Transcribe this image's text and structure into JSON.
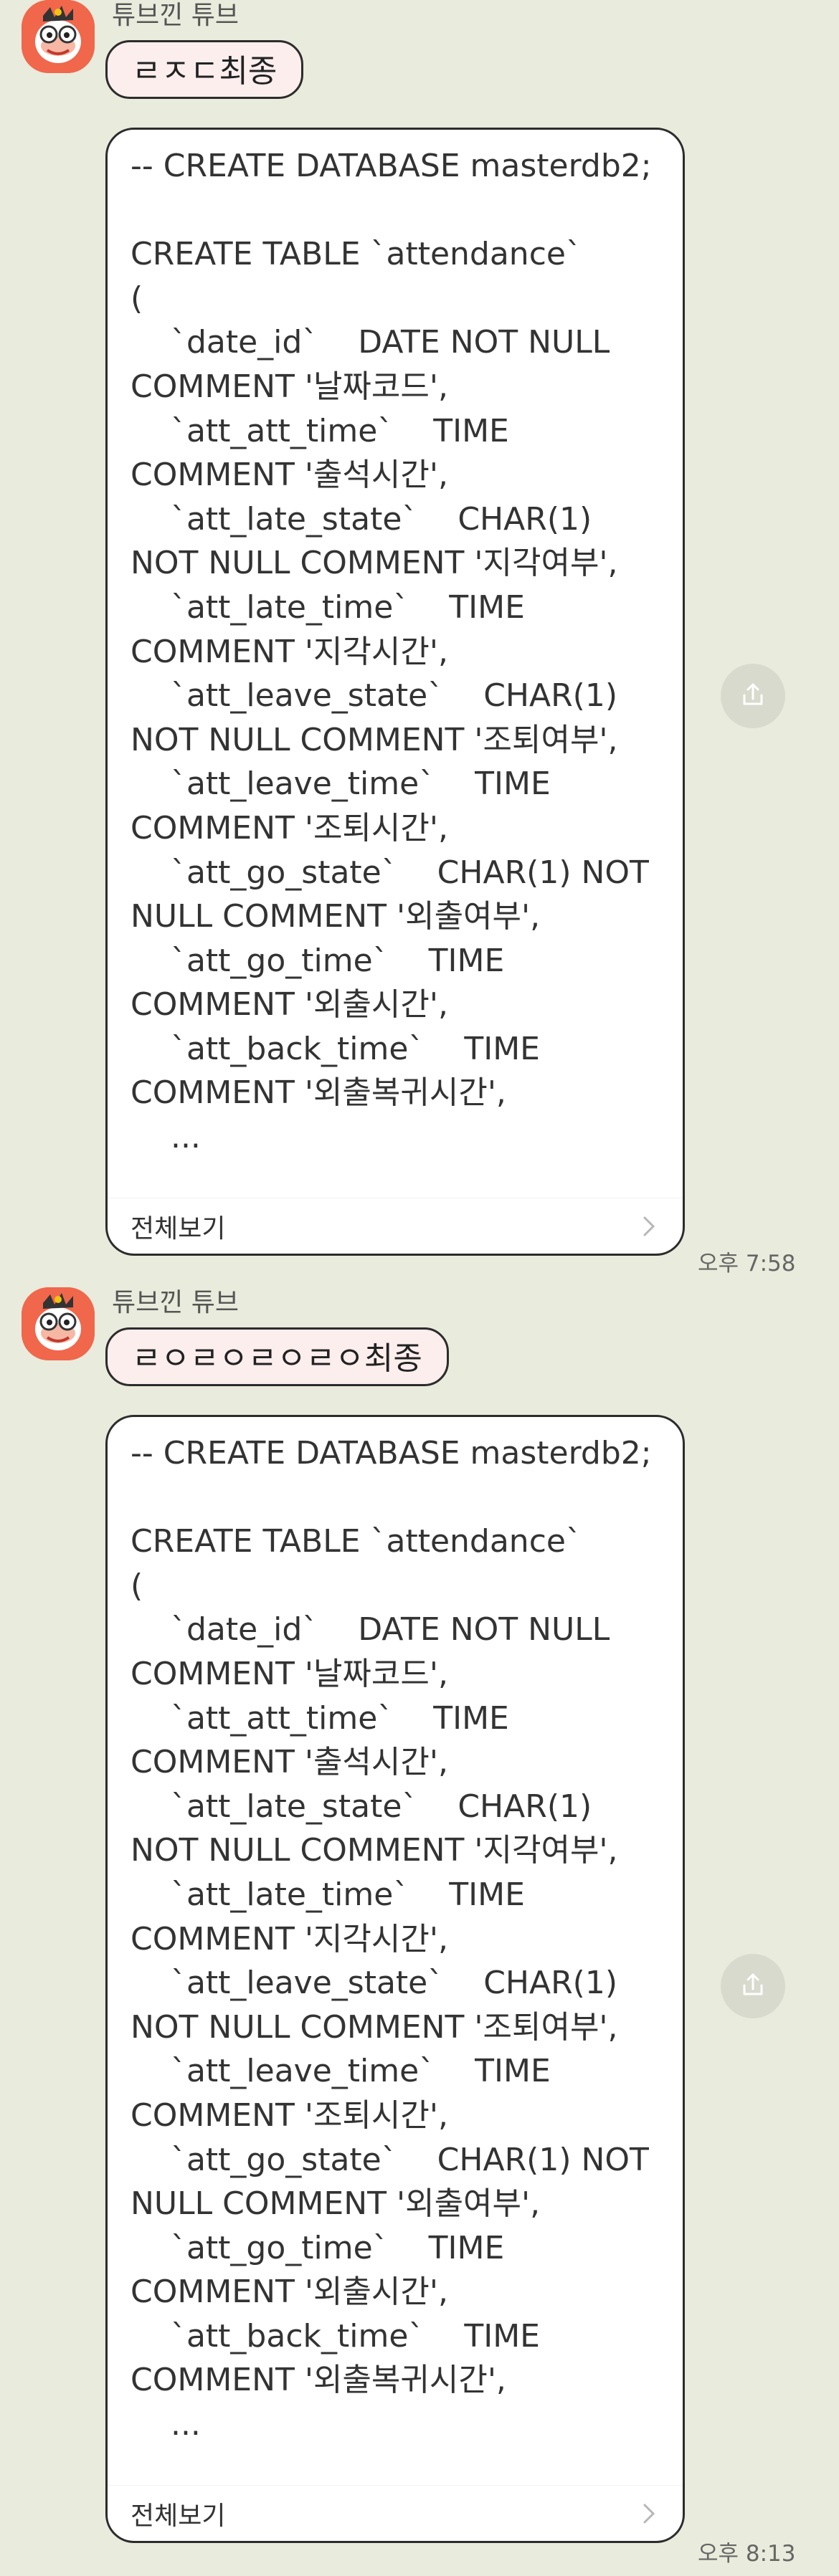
{
  "messages": [
    {
      "sender": "튜브낀 튜브",
      "short_text": "ㄹㅈㄷ최종",
      "code_text": "-- CREATE DATABASE masterdb2;\n\nCREATE TABLE `attendance`\n(\n    `date_id`    DATE NOT NULL COMMENT '날짜코드',\n    `att_att_time`    TIME COMMENT '출석시간',\n    `att_late_state`    CHAR(1) NOT NULL COMMENT '지각여부',\n    `att_late_time`    TIME COMMENT '지각시간',\n    `att_leave_state`    CHAR(1) NOT NULL COMMENT '조퇴여부',\n    `att_leave_time`    TIME COMMENT '조퇴시간',\n    `att_go_state`    CHAR(1) NOT NULL COMMENT '외출여부',\n    `att_go_time`    TIME COMMENT '외출시간',\n    `att_back_time`    TIME COMMENT '외출복귀시간',\n    ...",
      "view_more_label": "전체보기",
      "time": "오후 7:58"
    },
    {
      "sender": "튜브낀 튜브",
      "short_text": "ㄹㅇㄹㅇㄹㅇㄹㅇ최종",
      "code_text": "-- CREATE DATABASE masterdb2;\n\nCREATE TABLE `attendance`\n(\n    `date_id`    DATE NOT NULL COMMENT '날짜코드',\n    `att_att_time`    TIME COMMENT '출석시간',\n    `att_late_state`    CHAR(1) NOT NULL COMMENT '지각여부',\n    `att_late_time`    TIME COMMENT '지각시간',\n    `att_leave_state`    CHAR(1) NOT NULL COMMENT '조퇴여부',\n    `att_leave_time`    TIME COMMENT '조퇴시간',\n    `att_go_state`    CHAR(1) NOT NULL COMMENT '외출여부',\n    `att_go_time`    TIME COMMENT '외출시간',\n    `att_back_time`    TIME COMMENT '외출복귀시간',\n    ...",
      "view_more_label": "전체보기",
      "time": "오후 8:13"
    }
  ],
  "colors": {
    "background": "#e9ebdc",
    "short_bubble": "#fdeeee",
    "long_bubble": "#ffffff",
    "avatar": "#f0674c",
    "share_button": "#d8dacd"
  },
  "icons": {
    "avatar": "tube-character-avatar",
    "share": "share-icon",
    "chevron": "chevron-right-icon"
  }
}
